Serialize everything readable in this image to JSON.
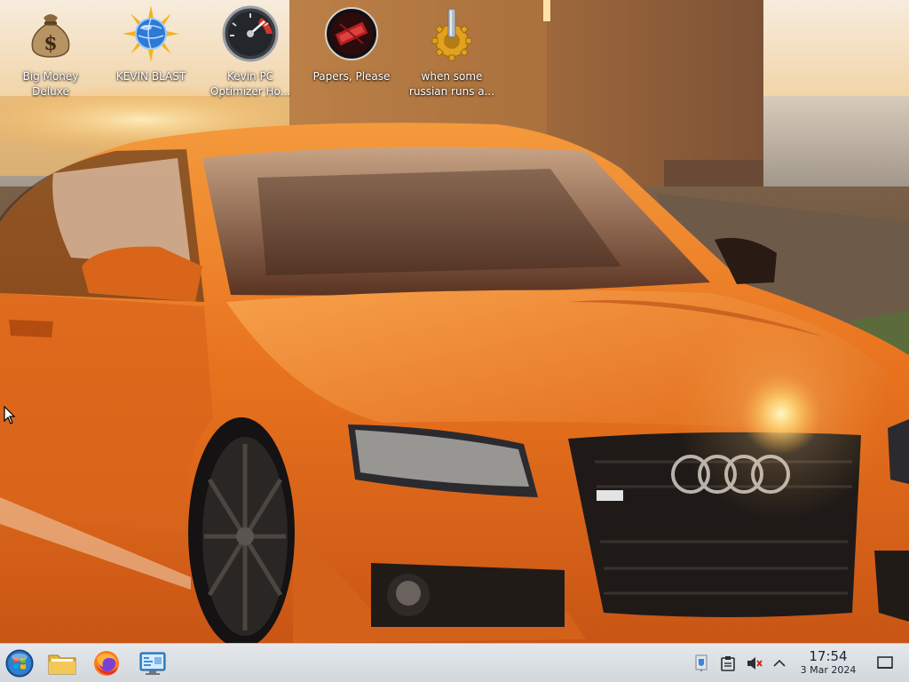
{
  "desktop": {
    "icons": [
      {
        "label": "Big Money\nDeluxe",
        "icon": "money-bag-icon"
      },
      {
        "label": "KEVIN BLAST",
        "icon": "globe-burst-icon"
      },
      {
        "label": "Kevin PC\nOptimizer Ho...",
        "icon": "speedometer-icon"
      },
      {
        "label": "Papers, Please",
        "icon": "papers-please-icon"
      },
      {
        "label": "when some\nrussian runs a...",
        "icon": "gear-icon"
      }
    ]
  },
  "taskbar": {
    "pinned": [
      {
        "name": "start",
        "icon": "start-orb-icon"
      },
      {
        "name": "file-manager",
        "icon": "folder-icon"
      },
      {
        "name": "firefox",
        "icon": "firefox-icon"
      },
      {
        "name": "control-panel",
        "icon": "control-panel-icon"
      }
    ],
    "tray": [
      {
        "name": "security",
        "icon": "shield-icon"
      },
      {
        "name": "clipboard",
        "icon": "clipboard-icon"
      },
      {
        "name": "volume",
        "icon": "volume-muted-icon"
      },
      {
        "name": "overflow",
        "icon": "chevron-up-icon"
      }
    ],
    "clock": {
      "time": "17:54",
      "date": "3 Mar 2024"
    }
  },
  "colors": {
    "taskbar_bg": "#dde1e5",
    "car_orange": "#e8731f",
    "icon_label": "#ffffff"
  }
}
